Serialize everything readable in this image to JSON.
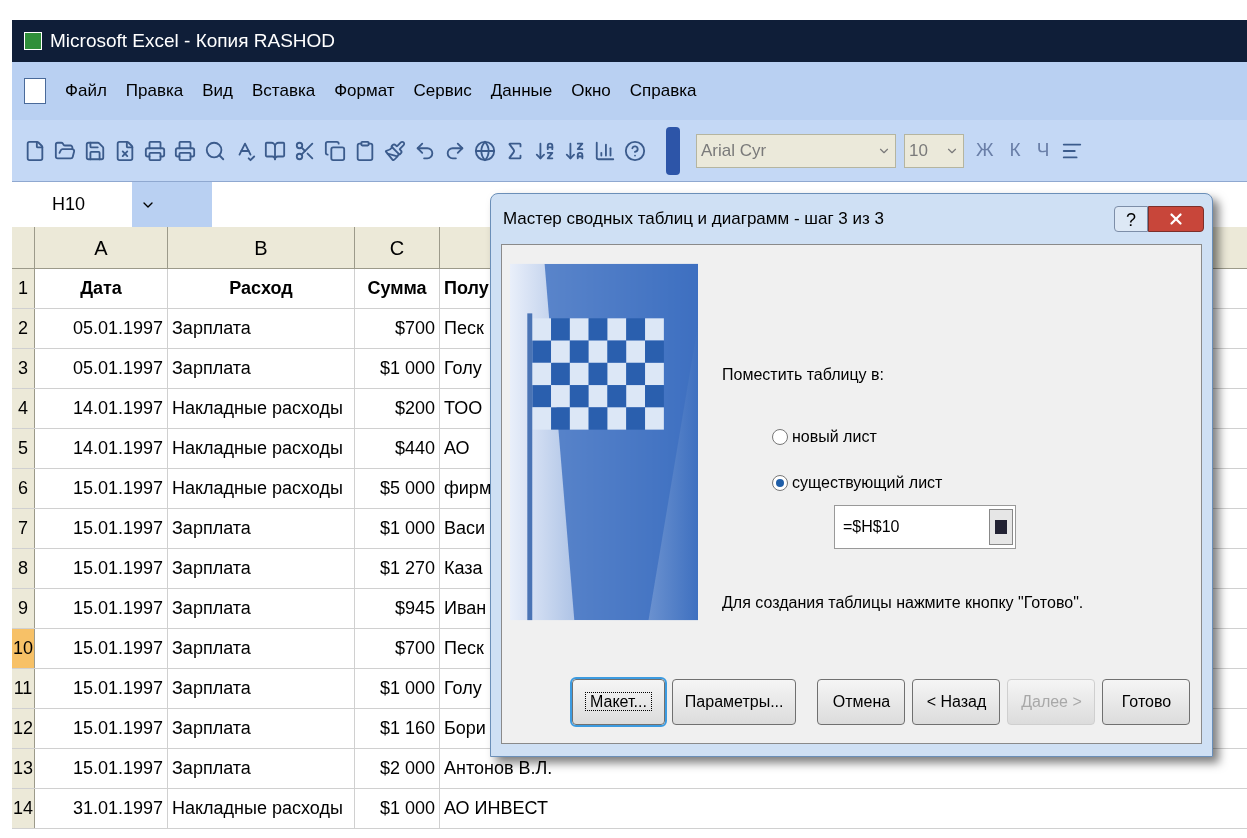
{
  "window": {
    "title": "Microsoft Excel - Копия RASHOD"
  },
  "menu": [
    "Файл",
    "Правка",
    "Вид",
    "Вставка",
    "Формат",
    "Сервис",
    "Данные",
    "Окно",
    "Справка"
  ],
  "format_toolbar": {
    "font": "Arial Cyr",
    "size": "10",
    "style_buttons": [
      "Ж",
      "К",
      "Ч"
    ]
  },
  "formula_bar": {
    "name_box": "H10"
  },
  "sheet": {
    "columns": [
      "A",
      "B",
      "C"
    ],
    "rows": [
      {
        "header": "1",
        "selected": false,
        "cells": [
          "Дата",
          "Расход",
          "Сумма",
          "Полу"
        ]
      },
      {
        "header": "2",
        "selected": false,
        "cells": [
          "05.01.1997",
          "Зарплата",
          "$700",
          "Песк"
        ]
      },
      {
        "header": "3",
        "selected": false,
        "cells": [
          "05.01.1997",
          "Зарплата",
          "$1 000",
          "Голу"
        ]
      },
      {
        "header": "4",
        "selected": false,
        "cells": [
          "14.01.1997",
          "Накладные расходы",
          "$200",
          "ТОО"
        ]
      },
      {
        "header": "5",
        "selected": false,
        "cells": [
          "14.01.1997",
          "Накладные расходы",
          "$440",
          "АО"
        ]
      },
      {
        "header": "6",
        "selected": false,
        "cells": [
          "15.01.1997",
          "Накладные расходы",
          "$5 000",
          "фирм"
        ]
      },
      {
        "header": "7",
        "selected": false,
        "cells": [
          "15.01.1997",
          "Зарплата",
          "$1 000",
          "Васи"
        ]
      },
      {
        "header": "8",
        "selected": false,
        "cells": [
          "15.01.1997",
          "Зарплата",
          "$1 270",
          "Каза"
        ]
      },
      {
        "header": "9",
        "selected": false,
        "cells": [
          "15.01.1997",
          "Зарплата",
          "$945",
          "Иван"
        ]
      },
      {
        "header": "10",
        "selected": true,
        "cells": [
          "15.01.1997",
          "Зарплата",
          "$700",
          "Песк"
        ]
      },
      {
        "header": "11",
        "selected": false,
        "cells": [
          "15.01.1997",
          "Зарплата",
          "$1 000",
          "Голу"
        ]
      },
      {
        "header": "12",
        "selected": false,
        "cells": [
          "15.01.1997",
          "Зарплата",
          "$1 160",
          "Бори"
        ]
      },
      {
        "header": "13",
        "selected": false,
        "cells": [
          "15.01.1997",
          "Зарплата",
          "$2 000",
          "Антонов В.Л."
        ]
      },
      {
        "header": "14",
        "selected": false,
        "cells": [
          "31.01.1997",
          "Накладные расходы",
          "$1 000",
          "АО ИНВЕСТ"
        ]
      }
    ]
  },
  "dialog": {
    "title": "Мастер сводных таблиц и диаграмм - шаг 3 из 3",
    "help": "?",
    "prompt": "Поместить таблицу в:",
    "options": [
      {
        "label": "новый лист",
        "selected": false
      },
      {
        "label": "существующий лист",
        "selected": true
      }
    ],
    "location": "=$H$10",
    "hint": "Для создания таблицы нажмите кнопку \"Готово\".",
    "buttons": [
      {
        "label": "Макет...",
        "disabled": false,
        "focused": true
      },
      {
        "label": "Параметры...",
        "disabled": false,
        "focused": false
      },
      {
        "label": "Отмена",
        "disabled": false,
        "focused": false
      },
      {
        "label": "< Назад",
        "disabled": false,
        "focused": false
      },
      {
        "label": "Далее >",
        "disabled": true,
        "focused": false
      },
      {
        "label": "Готово",
        "disabled": false,
        "focused": false
      }
    ]
  }
}
